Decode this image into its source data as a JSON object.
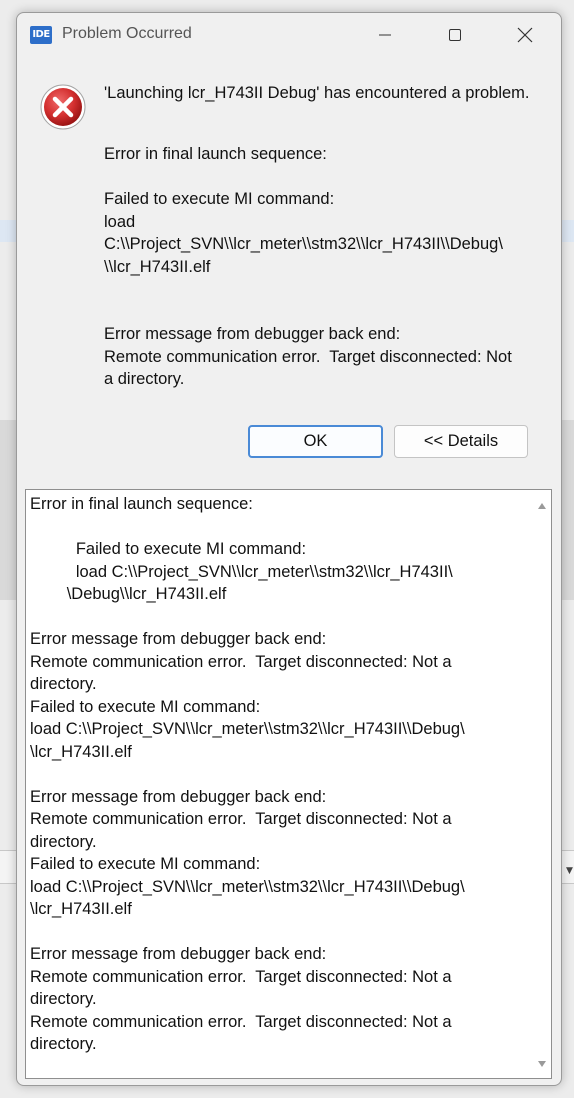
{
  "window": {
    "app_icon_label": "IDE",
    "title": "Problem Occurred"
  },
  "message": {
    "headline": "'Launching lcr_H743II Debug' has encountered a problem.",
    "body": "Error in final launch sequence:\n\nFailed to execute MI command:\nload\nC:\\\\Project_SVN\\\\lcr_meter\\\\stm32\\\\lcr_H743II\\\\Debug\\\n\\\\lcr_H743II.elf\n\n\nError message from debugger back end:\nRemote communication error.  Target disconnected: Not\na directory."
  },
  "buttons": {
    "ok_label": "OK",
    "details_label": "<< Details"
  },
  "details": {
    "text": "Error in final launch sequence:\n\n          Failed to execute MI command:\n          load C:\\\\Project_SVN\\\\lcr_meter\\\\stm32\\\\lcr_H743II\\\n        \\Debug\\\\lcr_H743II.elf\n\nError message from debugger back end:\nRemote communication error.  Target disconnected: Not a\ndirectory.\nFailed to execute MI command:\nload C:\\\\Project_SVN\\\\lcr_meter\\\\stm32\\\\lcr_H743II\\\\Debug\\\n\\lcr_H743II.elf\n\nError message from debugger back end:\nRemote communication error.  Target disconnected: Not a\ndirectory.\nFailed to execute MI command:\nload C:\\\\Project_SVN\\\\lcr_meter\\\\stm32\\\\lcr_H743II\\\\Debug\\\n\\lcr_H743II.elf\n\nError message from debugger back end:\nRemote communication error.  Target disconnected: Not a\ndirectory.\nRemote communication error.  Target disconnected: Not a\ndirectory."
  },
  "colors": {
    "dialog_bg": "#f0f0f0",
    "error_red": "#d32f2f",
    "ok_border": "#4a8ad6",
    "ide_icon_blue": "#2d6ec9"
  }
}
